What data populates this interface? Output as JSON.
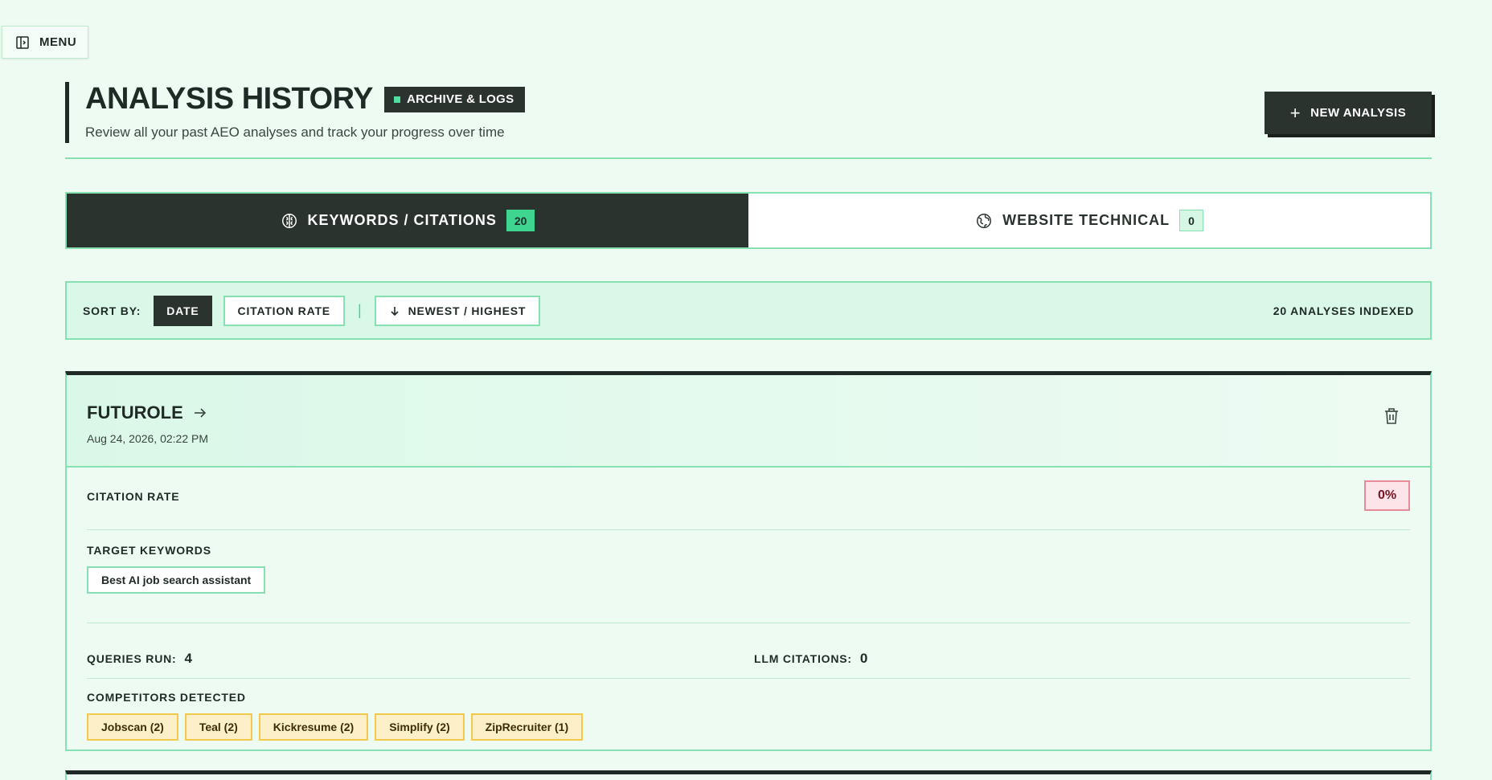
{
  "menu": {
    "label": "MENU"
  },
  "header": {
    "title": "ANALYSIS HISTORY",
    "badge": "ARCHIVE & LOGS",
    "subtitle": "Review all your past AEO analyses and track your progress over time",
    "new_button": "NEW ANALYSIS"
  },
  "tabs": [
    {
      "label": "KEYWORDS / CITATIONS",
      "count": "20",
      "icon": "brain-icon",
      "active": true
    },
    {
      "label": "WEBSITE TECHNICAL",
      "count": "0",
      "icon": "globe-icon",
      "active": false
    }
  ],
  "sort": {
    "label": "SORT BY:",
    "options": [
      "DATE",
      "CITATION RATE"
    ],
    "selected": "DATE",
    "order": "NEWEST / HIGHEST",
    "indexed": "20 ANALYSES INDEXED"
  },
  "card": {
    "name": "FUTUROLE",
    "date": "Aug 24, 2026, 02:22 PM",
    "citation_rate_label": "CITATION RATE",
    "citation_rate": "0%",
    "keywords_label": "TARGET KEYWORDS",
    "keywords": [
      "Best AI job search assistant"
    ],
    "queries_label": "QUERIES RUN:",
    "queries": "4",
    "llm_label": "LLM CITATIONS:",
    "llm": "0",
    "competitors_label": "COMPETITORS DETECTED",
    "competitors": [
      "Jobscan (2)",
      "Teal (2)",
      "Kickresume (2)",
      "Simplify (2)",
      "ZipRecruiter (1)"
    ]
  },
  "colors": {
    "background": "#eefbf3",
    "dark": "#2b332f",
    "accent": "#3ed591",
    "border": "#86e0b2",
    "danger": "#e98a9a",
    "warning": "#f2c94c"
  }
}
